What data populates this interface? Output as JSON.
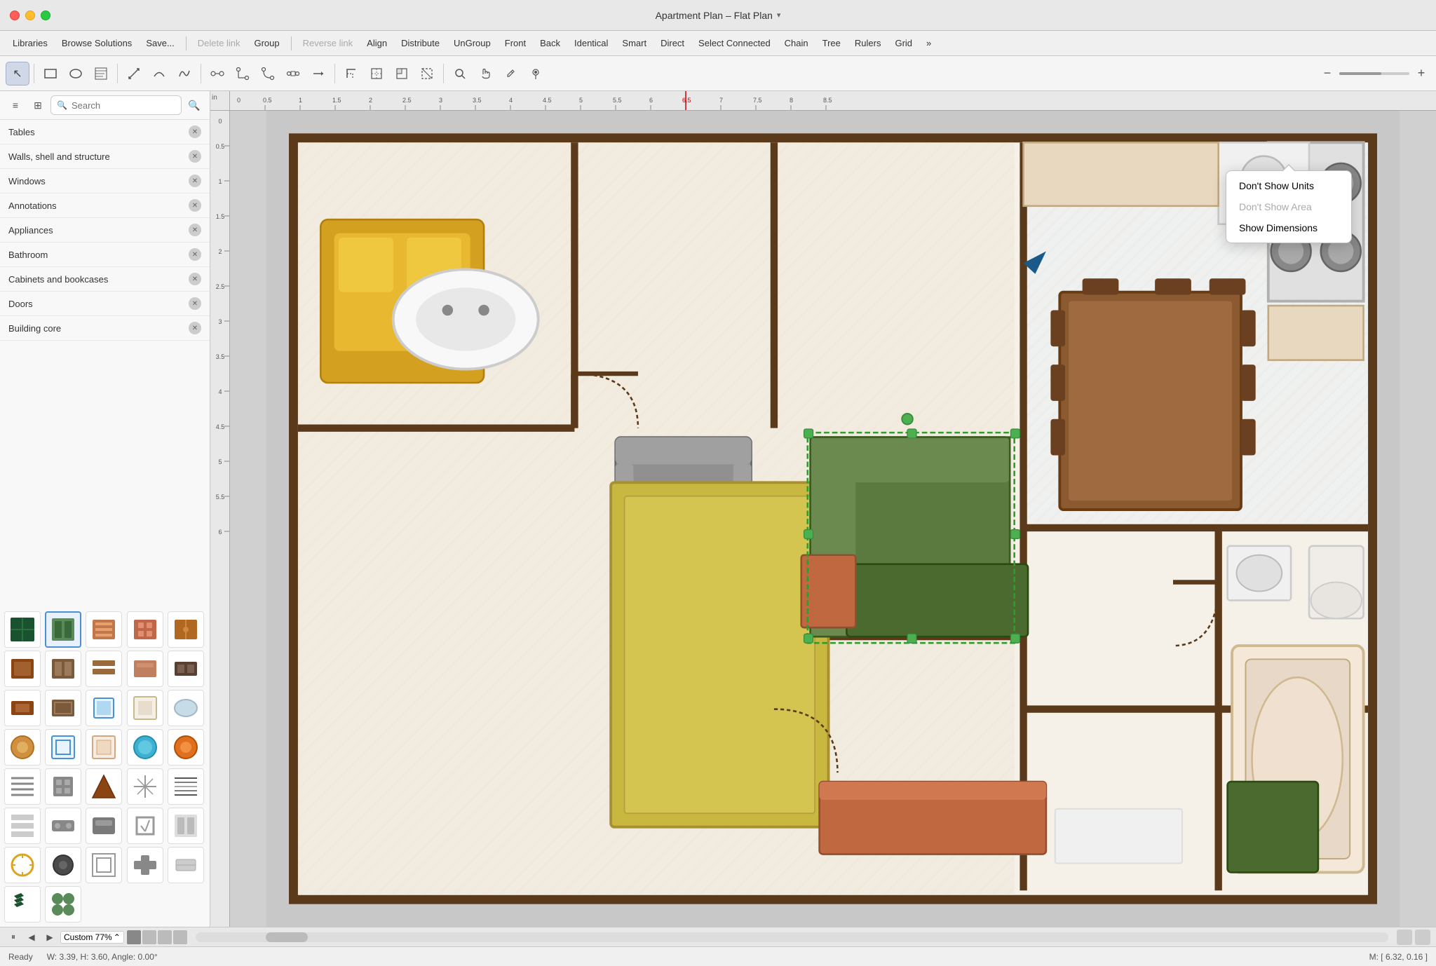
{
  "titlebar": {
    "title": "Apartment Plan – Flat Plan",
    "chevron": "▾"
  },
  "menubar": {
    "items": [
      {
        "id": "libraries",
        "label": "Libraries",
        "disabled": false
      },
      {
        "id": "browse",
        "label": "Browse Solutions",
        "disabled": false
      },
      {
        "id": "save",
        "label": "Save...",
        "disabled": false
      },
      {
        "id": "sep1",
        "type": "separator"
      },
      {
        "id": "delete-link",
        "label": "Delete link",
        "disabled": true
      },
      {
        "id": "group",
        "label": "Group",
        "disabled": false
      },
      {
        "id": "sep2",
        "type": "separator"
      },
      {
        "id": "reverse-link",
        "label": "Reverse link",
        "disabled": true
      },
      {
        "id": "align",
        "label": "Align",
        "disabled": false
      },
      {
        "id": "distribute",
        "label": "Distribute",
        "disabled": false
      },
      {
        "id": "ungroup",
        "label": "UnGroup",
        "disabled": false
      },
      {
        "id": "front",
        "label": "Front",
        "disabled": false
      },
      {
        "id": "back",
        "label": "Back",
        "disabled": false
      },
      {
        "id": "identical",
        "label": "Identical",
        "disabled": false
      },
      {
        "id": "smart",
        "label": "Smart",
        "disabled": false
      },
      {
        "id": "direct",
        "label": "Direct",
        "disabled": false
      },
      {
        "id": "select-connected",
        "label": "Select Connected",
        "disabled": false
      },
      {
        "id": "chain",
        "label": "Chain",
        "disabled": false
      },
      {
        "id": "tree",
        "label": "Tree",
        "disabled": false
      },
      {
        "id": "rulers",
        "label": "Rulers",
        "disabled": false
      },
      {
        "id": "grid",
        "label": "Grid",
        "disabled": false
      },
      {
        "id": "more",
        "label": "»",
        "disabled": false
      }
    ]
  },
  "toolbar": {
    "tools": [
      {
        "id": "select",
        "icon": "↖",
        "active": true
      },
      {
        "id": "rect",
        "icon": "▭"
      },
      {
        "id": "ellipse",
        "icon": "○"
      },
      {
        "id": "text",
        "icon": "▤"
      },
      {
        "id": "pen1",
        "icon": "✏"
      },
      {
        "id": "pen2",
        "icon": "⌒"
      },
      {
        "id": "pen3",
        "icon": "∿"
      },
      {
        "id": "sep1",
        "type": "separator"
      },
      {
        "id": "t1",
        "icon": "⊞"
      },
      {
        "id": "t2",
        "icon": "⊟"
      },
      {
        "id": "t3",
        "icon": "⊠"
      },
      {
        "id": "t4",
        "icon": "⊡"
      },
      {
        "id": "t5",
        "icon": "⊹"
      },
      {
        "id": "sep2",
        "type": "separator"
      },
      {
        "id": "t6",
        "icon": "⌕"
      },
      {
        "id": "t7",
        "icon": "✥"
      },
      {
        "id": "t8",
        "icon": "⊕"
      },
      {
        "id": "t9",
        "icon": "⊗"
      },
      {
        "id": "t10",
        "icon": "⊘"
      },
      {
        "id": "sep3",
        "type": "separator"
      },
      {
        "id": "search-canvas",
        "icon": "🔍"
      },
      {
        "id": "hand",
        "icon": "✋"
      },
      {
        "id": "eyedrop",
        "icon": "💧"
      },
      {
        "id": "pin",
        "icon": "📍"
      }
    ],
    "zoom_minus": "−",
    "zoom_plus": "+"
  },
  "sidebar": {
    "view_icons": [
      "≡",
      "⊞",
      "🔍"
    ],
    "search_placeholder": "Search",
    "categories": [
      {
        "id": "tables",
        "label": "Tables"
      },
      {
        "id": "walls",
        "label": "Walls, shell and structure"
      },
      {
        "id": "windows",
        "label": "Windows"
      },
      {
        "id": "annotations",
        "label": "Annotations"
      },
      {
        "id": "appliances",
        "label": "Appliances"
      },
      {
        "id": "bathroom",
        "label": "Bathroom"
      },
      {
        "id": "cabinets",
        "label": "Cabinets and bookcases"
      },
      {
        "id": "doors",
        "label": "Doors"
      },
      {
        "id": "building-core",
        "label": "Building core"
      }
    ],
    "icon_grid": [
      {
        "id": 1,
        "color": "#2d6e3a",
        "selected": false
      },
      {
        "id": 2,
        "color": "#5a8a5a",
        "selected": true
      },
      {
        "id": 3,
        "color": "#8B4513",
        "selected": false
      },
      {
        "id": 4,
        "color": "#c0674a",
        "selected": false
      },
      {
        "id": 5,
        "color": "#c07030",
        "selected": false
      },
      {
        "id": 6,
        "color": "#8B4513",
        "selected": false
      },
      {
        "id": 7,
        "color": "#7a5a3a",
        "selected": false
      },
      {
        "id": 8,
        "color": "#9b6a3a",
        "selected": false
      },
      {
        "id": 9,
        "color": "#c08060",
        "selected": false
      },
      {
        "id": 10,
        "color": "#5a4030",
        "selected": false
      },
      {
        "id": 11,
        "color": "#8B4513",
        "selected": false
      },
      {
        "id": 12,
        "color": "#7a5a3a",
        "selected": false
      },
      {
        "id": 13,
        "color": "#4a90d9",
        "selected": false
      },
      {
        "id": 14,
        "color": "#f0e8d8",
        "selected": false
      },
      {
        "id": 15,
        "color": "#b0c0d0",
        "selected": false
      },
      {
        "id": 16,
        "color": "#c08040",
        "selected": false
      },
      {
        "id": 17,
        "color": "#5090b0",
        "selected": false
      },
      {
        "id": 18,
        "color": "#f0d0b0",
        "selected": false
      },
      {
        "id": 19,
        "color": "#4ab0d0",
        "selected": false
      },
      {
        "id": 20,
        "color": "#e07020",
        "selected": false
      },
      {
        "id": 21,
        "color": "#888",
        "selected": false
      },
      {
        "id": 22,
        "color": "#666",
        "selected": false
      },
      {
        "id": 23,
        "color": "#8B4513",
        "selected": false
      },
      {
        "id": 24,
        "color": "#999",
        "selected": false
      },
      {
        "id": 25,
        "color": "#444",
        "selected": false
      },
      {
        "id": 26,
        "color": "#ccc",
        "selected": false
      },
      {
        "id": 27,
        "color": "#888",
        "selected": false
      },
      {
        "id": 28,
        "color": "#7a7a7a",
        "selected": false
      },
      {
        "id": 29,
        "color": "#9a9a9a",
        "selected": false
      },
      {
        "id": 30,
        "color": "#aaa",
        "selected": false
      },
      {
        "id": 31,
        "color": "#daa520",
        "selected": false
      },
      {
        "id": 32,
        "color": "#6a6a6a",
        "selected": false
      },
      {
        "id": 33,
        "color": "#9a9a9a",
        "selected": false
      },
      {
        "id": 34,
        "color": "#888",
        "selected": false
      },
      {
        "id": 35,
        "color": "#bbb",
        "selected": false
      },
      {
        "id": 36,
        "color": "#2d6e3a",
        "selected": false
      },
      {
        "id": 37,
        "color": "#5a8a5a",
        "selected": false
      }
    ]
  },
  "context_menu": {
    "items": [
      {
        "id": "dont-show-units",
        "label": "Don't Show Units",
        "disabled": false
      },
      {
        "id": "dont-show-area",
        "label": "Don't Show Area",
        "disabled": true
      },
      {
        "id": "show-dimensions",
        "label": "Show Dimensions",
        "disabled": false
      }
    ]
  },
  "statusbar": {
    "ready": "Ready",
    "dimensions": "W: 3.39,  H: 3.60,  Angle: 0.00°",
    "mouse": "M: [ 6.32, 0.16 ]",
    "unit": "in"
  },
  "bottom_toolbar": {
    "zoom_label": "Custom 77%",
    "zoom_arrow": "⌃⌄",
    "nav_prev": "◀",
    "nav_next": "▶",
    "nav_add": "+"
  },
  "ruler": {
    "h_marks": [
      "0",
      "0.5",
      "1",
      "1.5",
      "2",
      "2.5",
      "3",
      "3.5",
      "4",
      "4.5",
      "5",
      "5.5",
      "6",
      "6.5",
      "7",
      "7.5",
      "8",
      "8.5"
    ],
    "v_marks": [
      "0",
      "0.5",
      "1",
      "1.5",
      "2",
      "2.5",
      "3",
      "3.5",
      "4",
      "4.5",
      "5",
      "5.5",
      "6"
    ]
  }
}
